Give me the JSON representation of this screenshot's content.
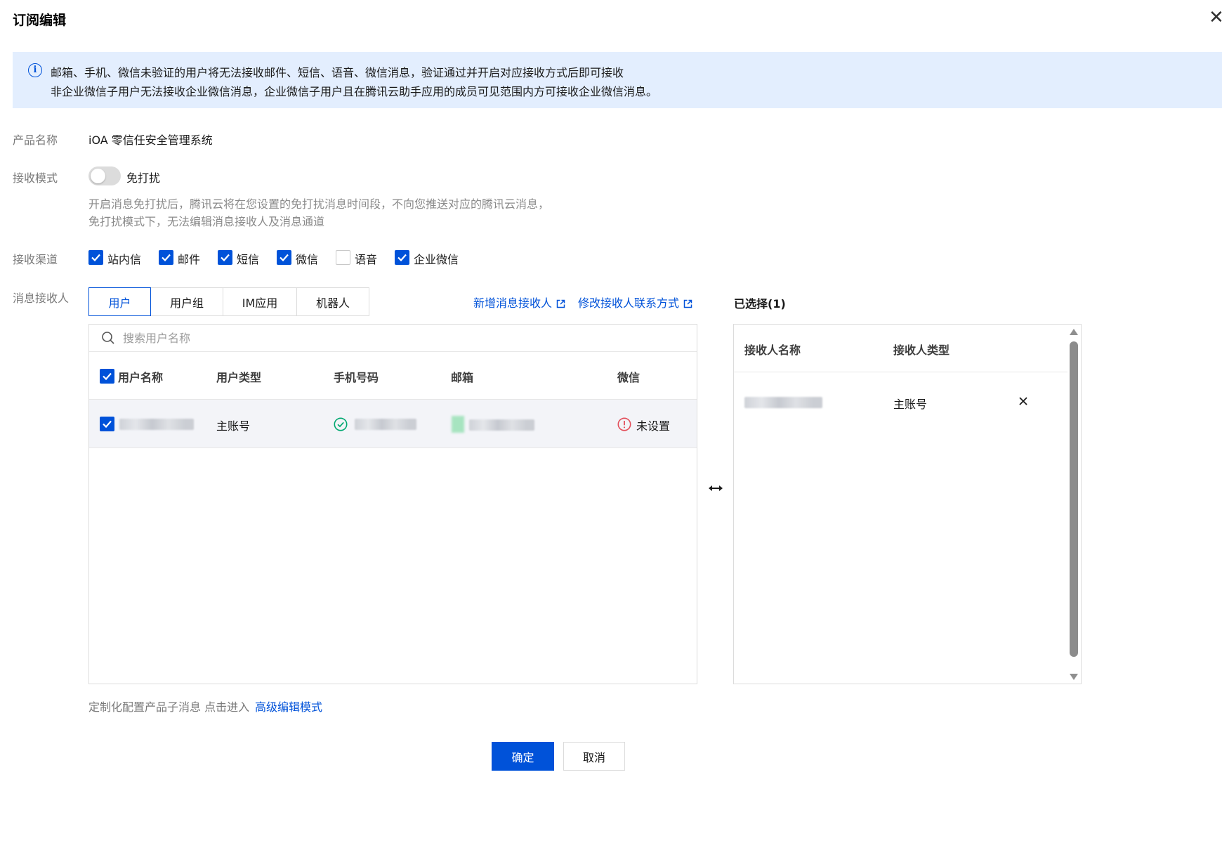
{
  "dialog": {
    "title": "订阅编辑",
    "close_icon": "close-icon"
  },
  "notice": {
    "icon": "info-icon",
    "line1": "邮箱、手机、微信未验证的用户将无法接收邮件、短信、语音、微信消息，验证通过并开启对应接收方式后即可接收",
    "line2": "非企业微信子用户无法接收企业微信消息，企业微信子用户且在腾讯云助手应用的成员可见范围内方可接收企业微信消息。"
  },
  "product": {
    "label": "产品名称",
    "value": "iOA 零信任安全管理系统"
  },
  "receive_mode": {
    "label": "接收模式",
    "switch_label": "免打扰",
    "switch_on": false,
    "hint_line1": "开启消息免打扰后，腾讯云将在您设置的免打扰消息时间段，不向您推送对应的腾讯云消息，",
    "hint_line2": "免打扰模式下，无法编辑消息接收人及消息通道"
  },
  "channels": {
    "label": "接收渠道",
    "items": [
      {
        "label": "站内信",
        "checked": true
      },
      {
        "label": "邮件",
        "checked": true
      },
      {
        "label": "短信",
        "checked": true
      },
      {
        "label": "微信",
        "checked": true
      },
      {
        "label": "语音",
        "checked": false
      },
      {
        "label": "企业微信",
        "checked": true
      }
    ]
  },
  "recipients": {
    "label": "消息接收人",
    "tabs": [
      {
        "label": "用户",
        "active": true
      },
      {
        "label": "用户组",
        "active": false
      },
      {
        "label": "IM应用",
        "active": false
      },
      {
        "label": "机器人",
        "active": false
      }
    ],
    "add_link": "新增消息接收人",
    "edit_link": "修改接收人联系方式",
    "search_placeholder": "搜索用户名称",
    "columns": [
      "用户名称",
      "用户类型",
      "手机号码",
      "邮箱",
      "微信"
    ],
    "rows": [
      {
        "checked": true,
        "user_type": "主账号",
        "phone_verified": true,
        "wechat_status": "未设置"
      }
    ],
    "selected_title": "已选择(1)",
    "selected_columns": [
      "接收人名称",
      "接收人类型"
    ],
    "selected_rows": [
      {
        "type": "主账号"
      }
    ]
  },
  "footer": {
    "text": "定制化配置产品子消息 点击进入",
    "link": "高级编辑模式"
  },
  "actions": {
    "confirm": "确定",
    "cancel": "取消"
  },
  "colors": {
    "primary": "#0052d9",
    "banner_bg": "#e3eefe",
    "success": "#00a870",
    "error": "#e34d59"
  }
}
